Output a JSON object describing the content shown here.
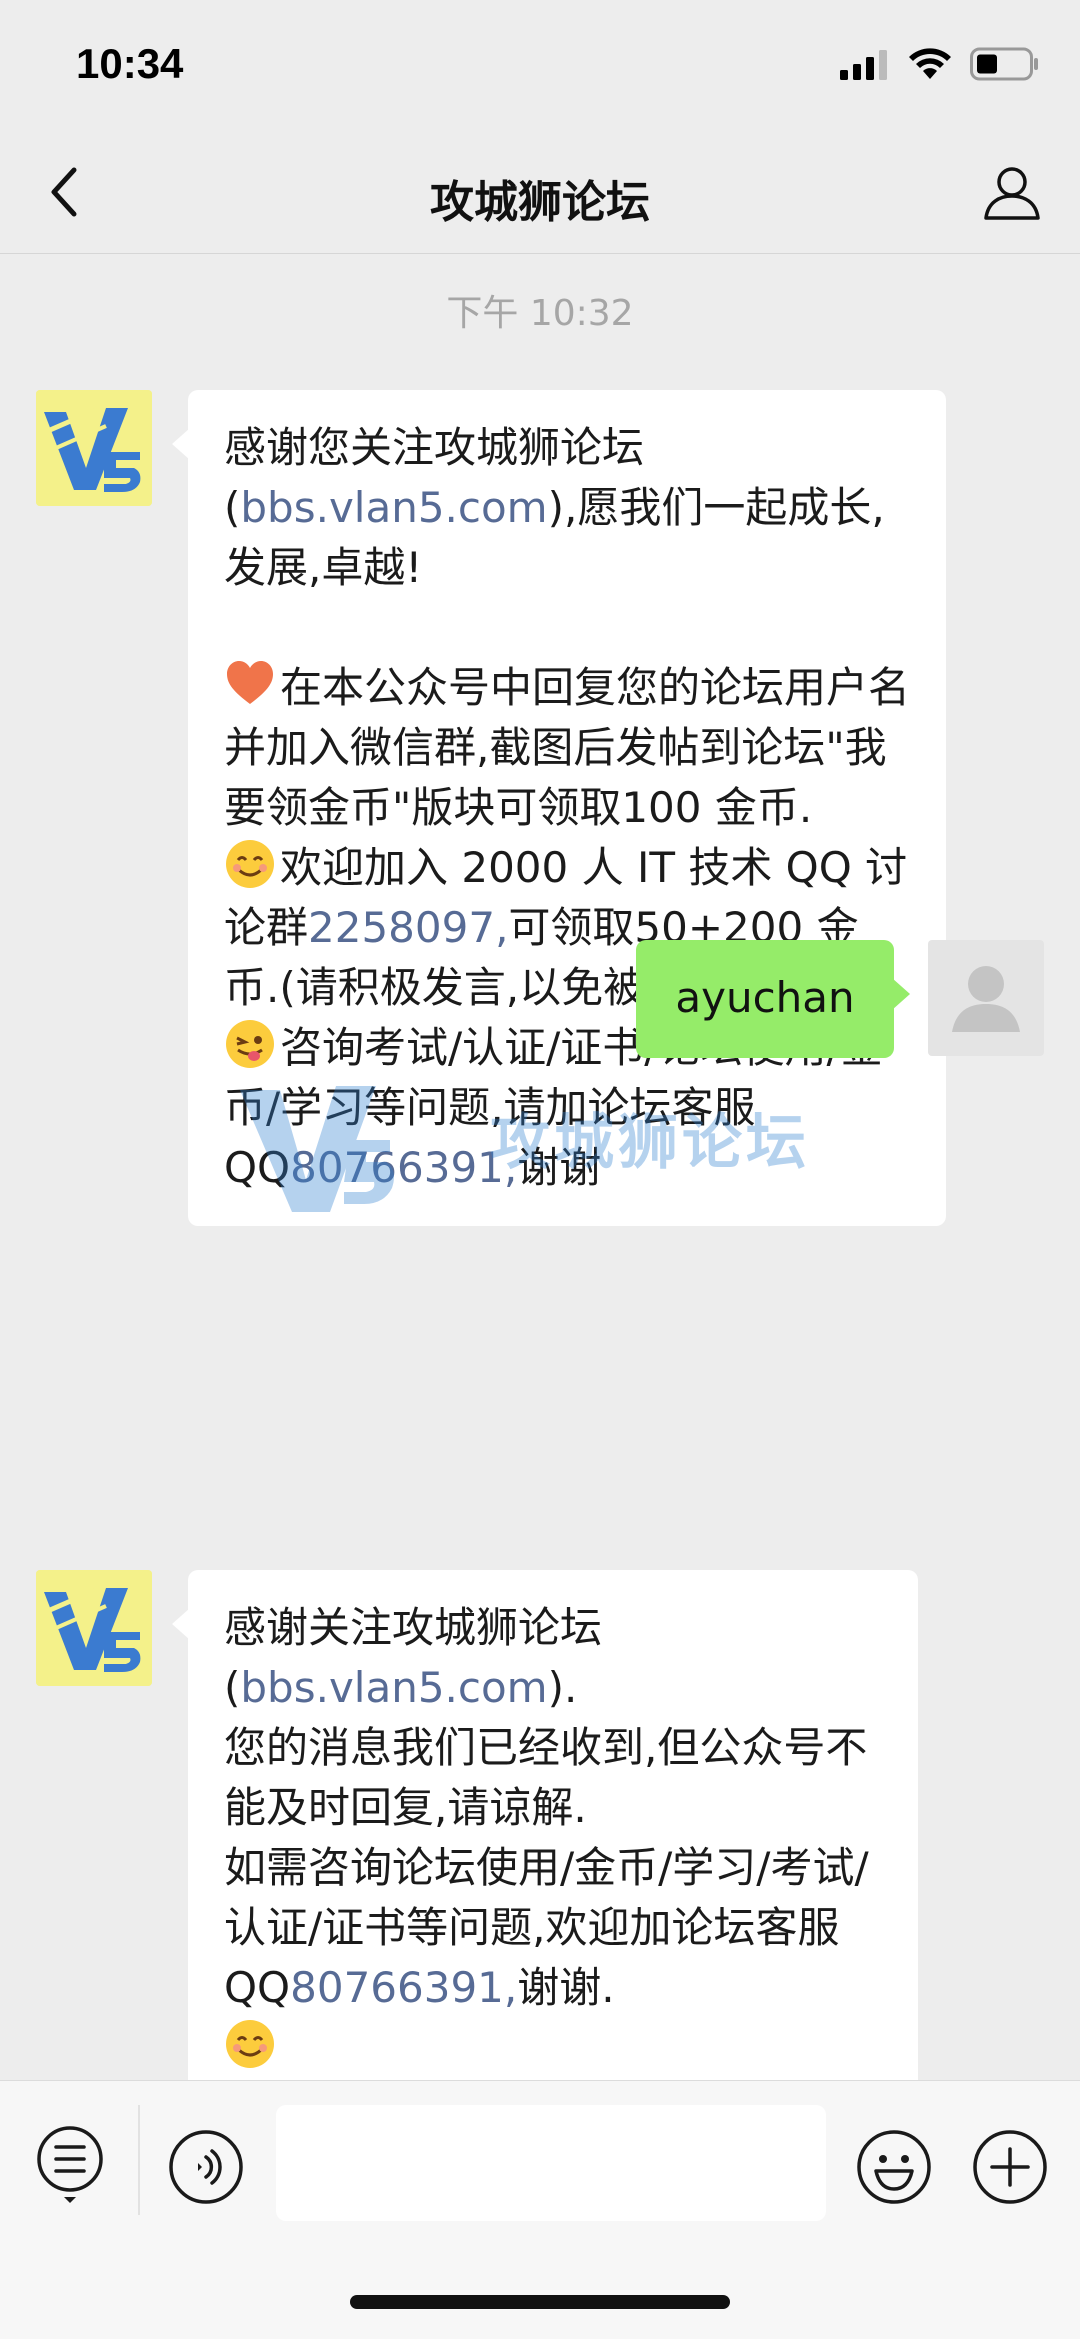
{
  "status": {
    "time": "10:34"
  },
  "nav": {
    "title": "攻城狮论坛"
  },
  "chat": {
    "time_label": "下午 10:32",
    "messages": [
      {
        "sender": "bot",
        "lines": {
          "l1a": "感谢您关注攻城狮论坛 (",
          "l1link": "bbs.vlan5.com",
          "l1b": "),愿我们一起成长,发展,卓越!",
          "p2": "在本公众号中回复您的论坛用户名并加入微信群,截图后发帖到论坛\"我要领金币\"版块可领取100 金币.",
          "p3a": "欢迎加入 2000 人 IT 技术 QQ 讨论群",
          "p3link": "2258097,",
          "p3b": "可领取50+200 金币.(请积极发言,以免被踢.)",
          "p4a": "咨询考试/认证/证书/论坛使用/金币/学习等问题,请加论坛客服 QQ",
          "p4link": "80766391,",
          "p4b": "谢谢"
        }
      },
      {
        "sender": "me",
        "text": "ayuchan"
      },
      {
        "sender": "bot",
        "lines": {
          "l1a": "感谢关注攻城狮论坛 (",
          "l1link": "bbs.vlan5.com",
          "l1b": ").",
          "p2": "您的消息我们已经收到,但公众号不能及时回复,请谅解.",
          "p3a": "如需咨询论坛使用/金币/学习/考试/认证/证书等问题,欢迎加论坛客服 QQ",
          "p3link": "80766391,",
          "p3b": "谢谢."
        }
      }
    ]
  },
  "watermark": {
    "text": "攻城狮论坛"
  },
  "colors": {
    "link": "#576b95",
    "my_bubble": "#95ec69",
    "background": "#ededed"
  }
}
